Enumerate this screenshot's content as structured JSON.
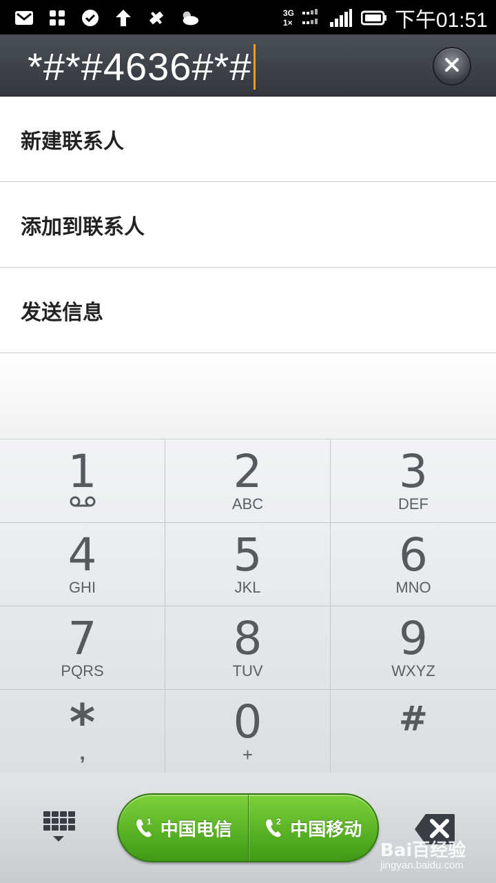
{
  "status_bar": {
    "time": "下午01:51",
    "net_top": "3G",
    "net_bottom": "1×",
    "left_icons": [
      "mail-icon",
      "apps-icon",
      "check-circle-icon",
      "upload-arrow-icon",
      "satellite-icon",
      "weather-cloud-icon"
    ],
    "right_icons": [
      "network-3g-1x-icon",
      "signal-bars-icon",
      "battery-icon"
    ]
  },
  "dialer": {
    "input_value": "*#*#4636#*#",
    "clear_icon": "clear-x-icon"
  },
  "options": [
    {
      "label": "新建联系人"
    },
    {
      "label": "添加到联系人"
    },
    {
      "label": "发送信息"
    }
  ],
  "keypad": [
    {
      "digit": "1",
      "letters": ""
    },
    {
      "digit": "2",
      "letters": "ABC"
    },
    {
      "digit": "3",
      "letters": "DEF"
    },
    {
      "digit": "4",
      "letters": "GHI"
    },
    {
      "digit": "5",
      "letters": "JKL"
    },
    {
      "digit": "6",
      "letters": "MNO"
    },
    {
      "digit": "7",
      "letters": "PQRS"
    },
    {
      "digit": "8",
      "letters": "TUV"
    },
    {
      "digit": "9",
      "letters": "WXYZ"
    },
    {
      "digit": "*",
      "letters": ","
    },
    {
      "digit": "0",
      "letters": "+"
    },
    {
      "digit": "#",
      "letters": ""
    }
  ],
  "bottom_bar": {
    "call1_label": "中国电信",
    "call1_sim": "1",
    "call2_label": "中国移动",
    "call2_sim": "2",
    "accent_green": "#4caf1e"
  },
  "watermark": {
    "text": "Bai百经验",
    "sub": "jingyan.baidu.com"
  }
}
